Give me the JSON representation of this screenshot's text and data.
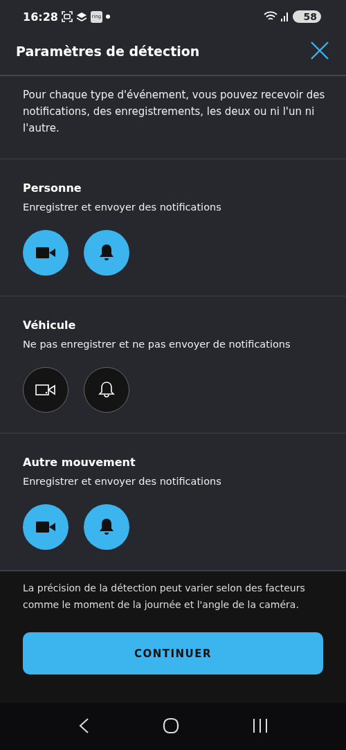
{
  "status_bar": {
    "time": "16:28",
    "app_badge": "ring",
    "battery": "58"
  },
  "header": {
    "title": "Paramètres de détection"
  },
  "intro": "Pour chaque type d'événement, vous pouvez recevoir des notifications, des enregistrements, les deux ou ni l'un ni l'autre.",
  "events": [
    {
      "title": "Personne",
      "subtitle": "Enregistrer et envoyer des notifications",
      "record_on": true,
      "notify_on": true
    },
    {
      "title": "Véhicule",
      "subtitle": "Ne pas enregistrer et ne pas envoyer de notifications",
      "record_on": false,
      "notify_on": false
    },
    {
      "title": "Autre mouvement",
      "subtitle": "Enregistrer et envoyer des notifications",
      "record_on": true,
      "notify_on": true
    }
  ],
  "footer": {
    "note": "La précision de la détection peut varier selon des facteurs comme le moment de la journée et l'angle de la caméra.",
    "button": "CONTINUER"
  }
}
